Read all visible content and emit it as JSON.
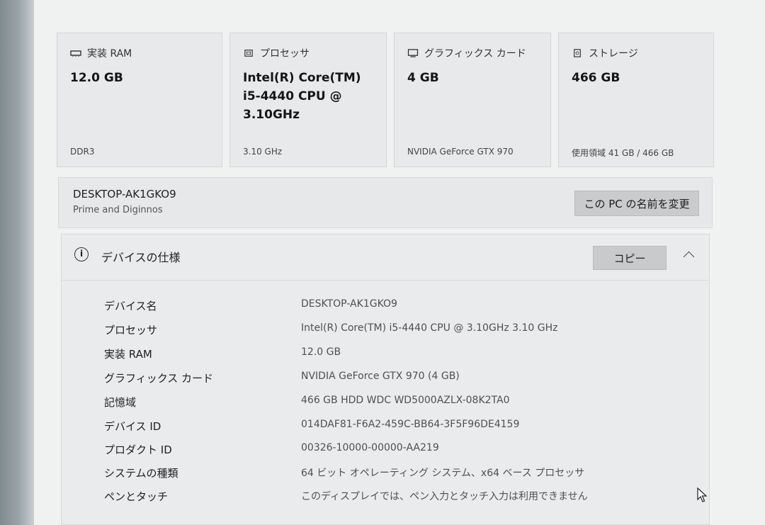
{
  "cards": [
    {
      "title": "実装 RAM",
      "value": "12.0 GB",
      "sub": "DDR3",
      "icon": "ram-icon"
    },
    {
      "title": "プロセッサ",
      "value": "Intel(R) Core(TM) i5-4440 CPU @ 3.10GHz",
      "sub": "3.10 GHz",
      "icon": "processor-icon"
    },
    {
      "title": "グラフィックス カード",
      "value": "4 GB",
      "sub": "NVIDIA GeForce GTX 970",
      "icon": "graphics-card-icon"
    },
    {
      "title": "ストレージ",
      "value": "466 GB",
      "sub": "使用領域 41 GB / 466 GB",
      "icon": "storage-icon"
    }
  ],
  "pc": {
    "name": "DESKTOP-AK1GKO9",
    "owner": "Prime and Diginnos",
    "rename_label": "この PC の名前を変更"
  },
  "specs": {
    "title": "デバイスの仕様",
    "copy_label": "コピー",
    "rows": [
      {
        "label": "デバイス名",
        "value": "DESKTOP-AK1GKO9"
      },
      {
        "label": "プロセッサ",
        "value": "Intel(R) Core(TM) i5-4440 CPU @ 3.10GHz   3.10 GHz"
      },
      {
        "label": "実装 RAM",
        "value": "12.0 GB"
      },
      {
        "label": "グラフィックス カード",
        "value": "NVIDIA GeForce GTX 970 (4 GB)"
      },
      {
        "label": "記憶域",
        "value": "466 GB HDD WDC WD5000AZLX-08K2TA0"
      },
      {
        "label": "デバイス ID",
        "value": "014DAF81-F6A2-459C-BB64-3F5F96DE4159"
      },
      {
        "label": "プロダクト ID",
        "value": "00326-10000-00000-AA219"
      },
      {
        "label": "システムの種類",
        "value": "64 ビット オペレーティング システム、x64 ベース プロセッサ"
      },
      {
        "label": "ペンとタッチ",
        "value": "このディスプレイでは、ペン入力とタッチ入力は利用できません"
      }
    ]
  }
}
